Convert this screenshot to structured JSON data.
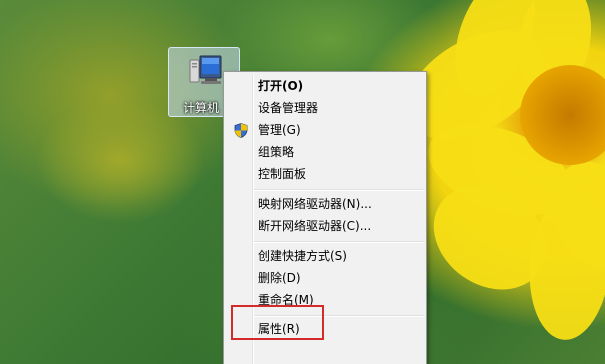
{
  "desktop": {
    "computer_icon": {
      "label": "计算机"
    }
  },
  "context_menu": {
    "groups": [
      [
        {
          "label": "打开(O)",
          "bold": true
        },
        {
          "label": "设备管理器"
        },
        {
          "label": "管理(G)",
          "icon": "uac-shield-icon"
        },
        {
          "label": "组策略"
        },
        {
          "label": "控制面板"
        }
      ],
      [
        {
          "label": "映射网络驱动器(N)..."
        },
        {
          "label": "断开网络驱动器(C)..."
        }
      ],
      [
        {
          "label": "创建快捷方式(S)"
        },
        {
          "label": "删除(D)"
        },
        {
          "label": "重命名(M)"
        }
      ],
      [
        {
          "label": "属性(R)"
        }
      ]
    ]
  },
  "annotation": {
    "highlight_color": "#d42a2a",
    "highlighted_item": "属性(R)"
  }
}
